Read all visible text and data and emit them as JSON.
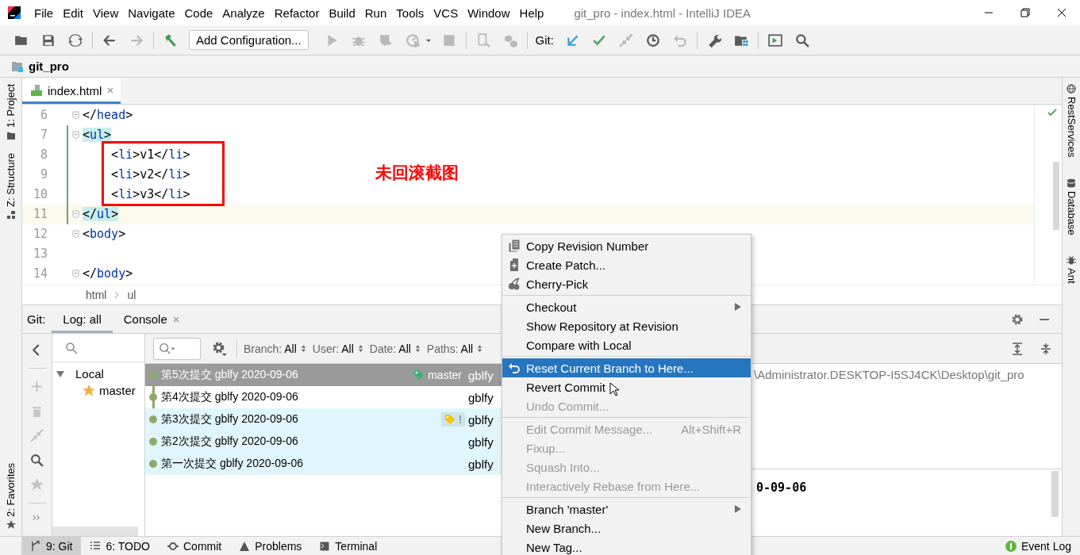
{
  "title_bar": {
    "menus": [
      "File",
      "Edit",
      "View",
      "Navigate",
      "Code",
      "Analyze",
      "Refactor",
      "Build",
      "Run",
      "Tools",
      "VCS",
      "Window",
      "Help"
    ],
    "title": "git_pro - index.html - IntelliJ IDEA"
  },
  "toolbar": {
    "run_config": "Add Configuration...",
    "git_label": "Git:",
    "buttons": [
      {
        "disabled": false
      },
      {
        "disabled": false
      },
      {
        "disabled": false
      },
      {
        "disabled": false
      },
      {
        "disabled": true
      },
      {
        "disabled": false
      },
      {
        "disabled": true
      },
      {
        "disabled": true
      },
      {
        "disabled": true
      },
      {
        "disabled": true
      },
      {
        "disabled": false
      },
      {
        "disabled": true
      },
      {
        "disabled": true
      },
      {
        "disabled": true
      },
      {
        "disabled": false
      },
      {
        "disabled": false
      },
      {
        "disabled": true
      },
      {
        "disabled": false
      },
      {
        "disabled": true
      },
      {
        "disabled": false
      },
      {
        "disabled": false
      },
      {
        "disabled": false
      },
      {
        "disabled": false
      }
    ]
  },
  "nav_bar": {
    "project": "git_pro"
  },
  "left_strip": {
    "top": [
      {
        "label": "1: Project"
      },
      {
        "label": "Z: Structure"
      }
    ],
    "bottom": [
      {
        "label": "2: Favorites"
      }
    ]
  },
  "right_strip": [
    {
      "label": "RestServices"
    },
    {
      "label": "Database"
    },
    {
      "label": "Ant"
    }
  ],
  "editor": {
    "tabs": [
      {
        "label": "index.html",
        "selected": true
      }
    ],
    "lines": [
      {
        "number": "6",
        "current": false,
        "changed": false,
        "fold": true,
        "tokens": [
          {
            "text": "</",
            "kind": "punct"
          },
          {
            "text": "head",
            "kind": "tag"
          },
          {
            "text": ">",
            "kind": "punct"
          }
        ]
      },
      {
        "number": "7",
        "current": false,
        "changed": true,
        "fold": true,
        "tokens": [
          {
            "text": "<",
            "kind": "match"
          },
          {
            "text": "ul",
            "kind": "match-tag"
          },
          {
            "text": ">",
            "kind": "match"
          }
        ]
      },
      {
        "number": "8",
        "current": false,
        "changed": true,
        "fold": false,
        "tokens": [
          {
            "text": "    <",
            "kind": "punct"
          },
          {
            "text": "li",
            "kind": "tag"
          },
          {
            "text": ">v1</",
            "kind": "punct"
          },
          {
            "text": "li",
            "kind": "tag"
          },
          {
            "text": ">",
            "kind": "punct"
          }
        ]
      },
      {
        "number": "9",
        "current": false,
        "changed": true,
        "fold": false,
        "tokens": [
          {
            "text": "    <",
            "kind": "punct"
          },
          {
            "text": "li",
            "kind": "tag"
          },
          {
            "text": ">v2</",
            "kind": "punct"
          },
          {
            "text": "li",
            "kind": "tag"
          },
          {
            "text": ">",
            "kind": "punct"
          }
        ]
      },
      {
        "number": "10",
        "current": false,
        "changed": true,
        "fold": false,
        "tokens": [
          {
            "text": "    <",
            "kind": "punct"
          },
          {
            "text": "li",
            "kind": "tag"
          },
          {
            "text": ">v3</",
            "kind": "punct"
          },
          {
            "text": "li",
            "kind": "tag"
          },
          {
            "text": ">",
            "kind": "punct"
          }
        ]
      },
      {
        "number": "11",
        "current": true,
        "changed": true,
        "fold": true,
        "tokens": [
          {
            "text": "</",
            "kind": "match"
          },
          {
            "text": "ul",
            "kind": "match-tag"
          },
          {
            "text": ">",
            "kind": "match"
          }
        ]
      },
      {
        "number": "12",
        "current": false,
        "changed": false,
        "fold": true,
        "tokens": [
          {
            "text": "<",
            "kind": "punct"
          },
          {
            "text": "body",
            "kind": "tag"
          },
          {
            "text": ">",
            "kind": "punct"
          }
        ]
      },
      {
        "number": "13",
        "current": false,
        "changed": false,
        "fold": false
      },
      {
        "number": "14",
        "current": false,
        "changed": false,
        "fold": true,
        "tokens": [
          {
            "text": "</",
            "kind": "punct"
          },
          {
            "text": "body",
            "kind": "tag"
          },
          {
            "text": ">",
            "kind": "punct"
          }
        ]
      }
    ],
    "annotation": "未回滚截图",
    "breadcrumbs": [
      "html",
      "ul"
    ]
  },
  "git_panel": {
    "label": "Git:",
    "tabs": [
      {
        "label": "Log: all",
        "selected": true,
        "closable": false
      },
      {
        "label": "Console",
        "selected": false,
        "closable": true
      }
    ],
    "branches": [
      {
        "label": "Local",
        "expanded": true,
        "children": [
          {
            "label": "master",
            "favorite": true
          }
        ]
      }
    ],
    "filters": [
      {
        "label": "Branch:",
        "value": "All"
      },
      {
        "label": "User:",
        "value": "All"
      },
      {
        "label": "Date:",
        "value": "All"
      },
      {
        "label": "Paths:",
        "value": "All"
      }
    ],
    "commits": [
      {
        "message": "第5次提交 gblfy 2020-09-06",
        "author": "gblfy",
        "selected": true,
        "highlighted": false,
        "ref": {
          "kind": "branch",
          "label": "master"
        }
      },
      {
        "message": "第4次提交 gblfy 2020-09-06",
        "author": "gblfy",
        "selected": false,
        "highlighted": false
      },
      {
        "message": "第3次提交 gblfy 2020-09-06",
        "author": "gblfy",
        "selected": false,
        "highlighted": true,
        "ref": {
          "kind": "warning-tag",
          "label": "!"
        }
      },
      {
        "message": "第2次提交 gblfy 2020-09-06",
        "author": "gblfy",
        "selected": false,
        "highlighted": true
      },
      {
        "message": "第一次提交 gblfy 2020-09-06",
        "author": "gblfy",
        "selected": false,
        "highlighted": true
      }
    ],
    "details": {
      "path": "\\Administrator.DESKTOP-I5SJ4CK\\Desktop\\git_pro",
      "date_fragment": "0-09-06"
    }
  },
  "context_menu": {
    "groups": [
      [
        {
          "label": "Copy Revision Number",
          "disabled": false,
          "selected": false,
          "submenu": false
        },
        {
          "label": "Create Patch...",
          "disabled": false,
          "selected": false,
          "submenu": false
        },
        {
          "label": "Cherry-Pick",
          "disabled": false,
          "selected": false,
          "submenu": false
        }
      ],
      [
        {
          "label": "Checkout",
          "disabled": false,
          "selected": false,
          "submenu": true
        },
        {
          "label": "Show Repository at Revision",
          "disabled": false,
          "selected": false,
          "submenu": false
        },
        {
          "label": "Compare with Local",
          "disabled": false,
          "selected": false,
          "submenu": false
        }
      ],
      [
        {
          "label": "Reset Current Branch to Here...",
          "disabled": false,
          "selected": true,
          "submenu": false
        },
        {
          "label": "Revert Commit",
          "disabled": false,
          "selected": false,
          "submenu": false
        },
        {
          "label": "Undo Commit...",
          "disabled": true,
          "selected": false,
          "submenu": false
        }
      ],
      [
        {
          "label": "Edit Commit Message...",
          "disabled": true,
          "selected": false,
          "submenu": false,
          "shortcut": "Alt+Shift+R"
        },
        {
          "label": "Fixup...",
          "disabled": true,
          "selected": false,
          "submenu": false
        },
        {
          "label": "Squash Into...",
          "disabled": true,
          "selected": false,
          "submenu": false
        },
        {
          "label": "Interactively Rebase from Here...",
          "disabled": true,
          "selected": false,
          "submenu": false
        }
      ],
      [
        {
          "label": "Branch 'master'",
          "disabled": false,
          "selected": false,
          "submenu": true
        },
        {
          "label": "New Branch...",
          "disabled": false,
          "selected": false,
          "submenu": false
        },
        {
          "label": "New Tag...",
          "disabled": false,
          "selected": false,
          "submenu": false
        }
      ]
    ]
  },
  "status_bar": {
    "tools": [
      {
        "label": "9: Git",
        "selected": true
      },
      {
        "label": "6: TODO",
        "selected": false
      },
      {
        "label": "Commit",
        "selected": false
      },
      {
        "label": "Problems",
        "selected": false
      },
      {
        "label": "Terminal",
        "selected": false
      }
    ],
    "event_log": "Event Log"
  }
}
